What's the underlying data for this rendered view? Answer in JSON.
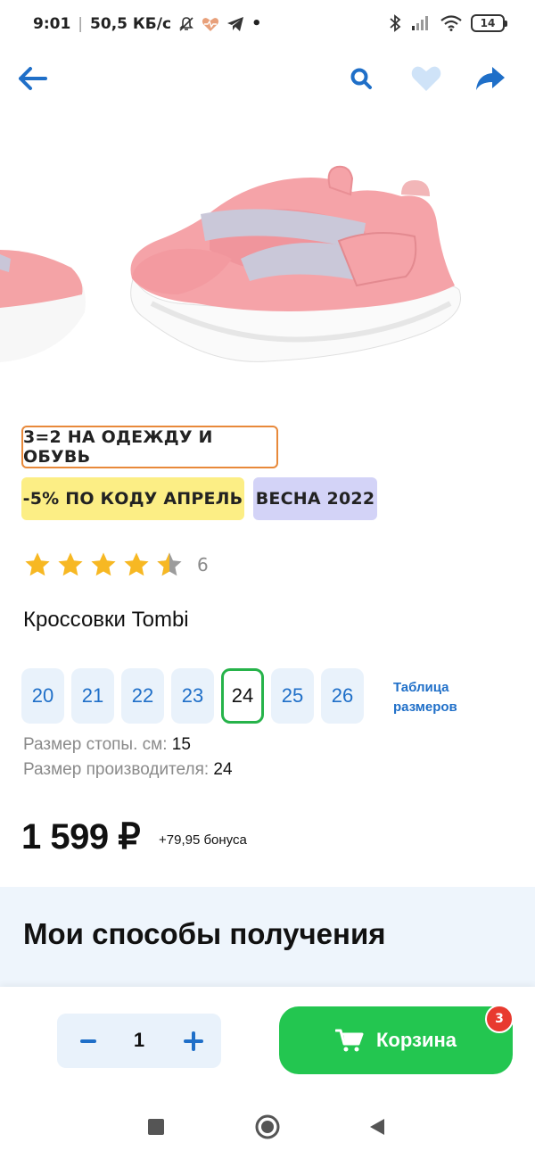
{
  "status_bar": {
    "time": "9:01",
    "speed": "50,5 КБ/с",
    "battery": "14"
  },
  "top_bar": {
    "icons": [
      "back-arrow-icon",
      "search-icon",
      "heart-icon",
      "share-icon"
    ],
    "accent_color": "#1f6fc8"
  },
  "product": {
    "image": "pink-kids-sneakers",
    "promos": [
      {
        "label": "3=2 НА ОДЕЖДУ И ОБУВЬ",
        "color": "#e8893a"
      },
      {
        "label": "-5% ПО КОДУ АПРЕЛЬ",
        "color": "#fcee85"
      },
      {
        "label": "ВЕСНА 2022",
        "color": "#d3d3f7"
      }
    ],
    "rating": {
      "value": 4.5,
      "max": 5,
      "count": "6"
    },
    "title": "Кроссовки Tombi",
    "sizes": [
      "20",
      "21",
      "22",
      "23",
      "24",
      "25",
      "26"
    ],
    "selected_size": "24",
    "size_table_link": [
      "Таблица",
      "размеров"
    ],
    "foot_size_label": "Размер стопы. см:",
    "foot_size_value": "15",
    "maker_size_label": "Размер производителя:",
    "maker_size_value": "24",
    "price": "1 599 ₽",
    "bonus": "+79,95 бонуса"
  },
  "delivery": {
    "title": "Мои способы получения"
  },
  "cart_bar": {
    "quantity": "1",
    "cart_label": "Корзина",
    "cart_count": "3",
    "cart_color": "#23c650",
    "badge_color": "#e83a2f"
  },
  "nav": {
    "buttons": [
      "recent-apps-icon",
      "home-icon",
      "back-icon"
    ]
  }
}
